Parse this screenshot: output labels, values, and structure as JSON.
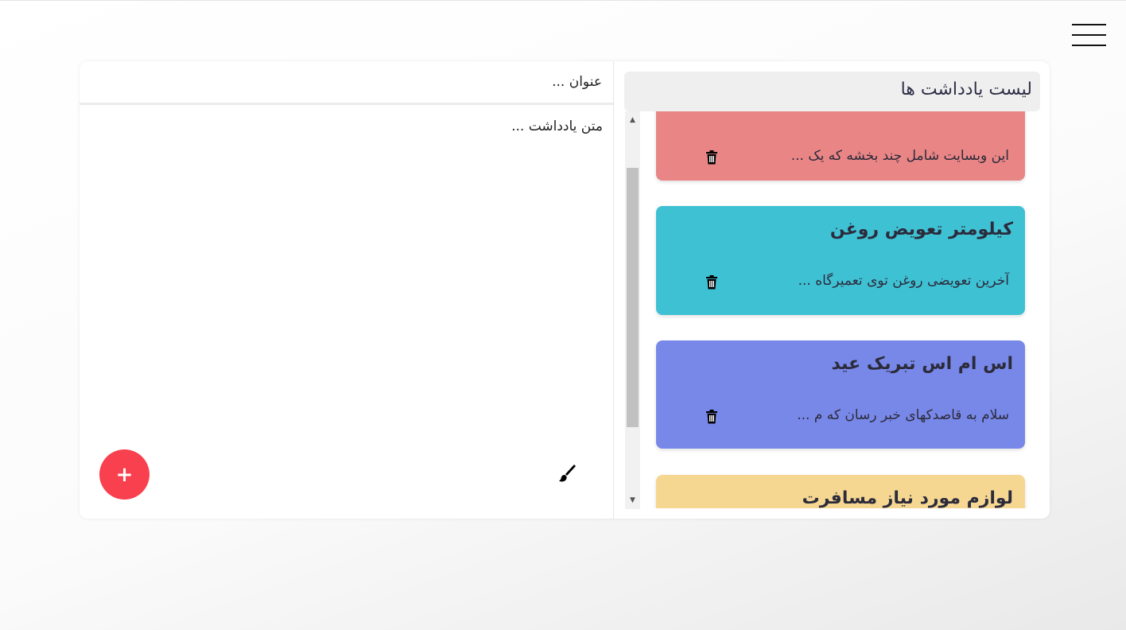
{
  "menu": {
    "icon": "hamburger-menu-icon"
  },
  "editor": {
    "title_placeholder": "عنوان ...",
    "body_placeholder": "متن یادداشت ...",
    "brush_icon": "paint-brush-icon",
    "add_label": "+",
    "add_color": "#f8404f"
  },
  "list": {
    "header": "لیست یادداشت ها",
    "notes": [
      {
        "title": "",
        "text": "این وبسایت شامل چند بخشه که یک ...",
        "color": "#e98585",
        "icon": "trash-icon"
      },
      {
        "title": "کیلومتر تعویض روغن",
        "text": "آخرین تعویضی روغن توی تعمیرگاه ...",
        "color": "#3fc1d4",
        "icon": "trash-icon"
      },
      {
        "title": "اس ام اس تبریک عید",
        "text": "سلام به قاصدکهای خبر رسان که م ...",
        "color": "#7888e8",
        "icon": "trash-icon"
      },
      {
        "title": "لوازم مورد نیاز مسافرت",
        "text": "",
        "color": "#f6d791",
        "icon": "trash-icon"
      }
    ]
  }
}
